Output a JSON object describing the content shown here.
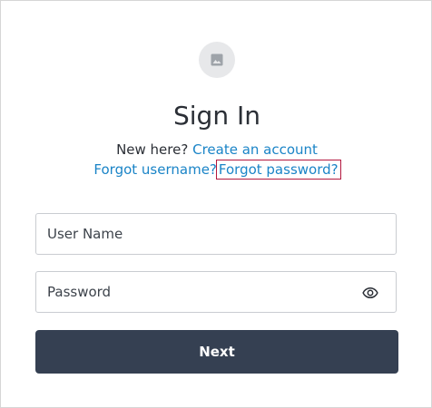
{
  "header": {
    "avatar_icon": "image-placeholder-icon",
    "title": "Sign In"
  },
  "links": {
    "new_here_text": "New here?",
    "create_account": "Create an account",
    "forgot_username": "Forgot username?",
    "forgot_password": "Forgot password?"
  },
  "form": {
    "username": {
      "value": "",
      "placeholder": "User Name"
    },
    "password": {
      "value": "",
      "placeholder": "Password",
      "toggle_icon": "eye-icon"
    },
    "submit_label": "Next"
  },
  "colors": {
    "link": "#1a84c7",
    "button": "#354052",
    "focus_outline": "#b3183f"
  }
}
